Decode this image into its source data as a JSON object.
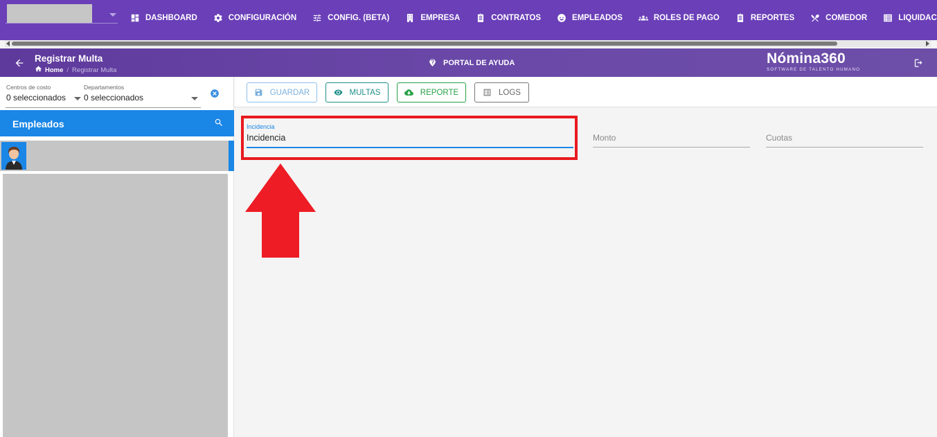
{
  "nav": {
    "items": [
      {
        "label": "DASHBOARD",
        "icon": "dashboard-icon"
      },
      {
        "label": "CONFIGURACIÓN",
        "icon": "gear-icon"
      },
      {
        "label": "CONFIG. (BETA)",
        "icon": "tune-icon"
      },
      {
        "label": "EMPRESA",
        "icon": "building-icon"
      },
      {
        "label": "CONTRATOS",
        "icon": "clipboard-icon"
      },
      {
        "label": "EMPLEADOS",
        "icon": "face-icon"
      },
      {
        "label": "ROLES DE PAGO",
        "icon": "group-icon"
      },
      {
        "label": "REPORTES",
        "icon": "clipboard-icon"
      },
      {
        "label": "COMEDOR",
        "icon": "cutlery-icon"
      },
      {
        "label": "LIQUIDACIONES",
        "icon": "list-icon"
      }
    ]
  },
  "header": {
    "title": "Registrar Multa",
    "breadcrumb_home": "Home",
    "breadcrumb_sep": "/",
    "breadcrumb_current": "Registrar Multa",
    "help_label": "PORTAL DE AYUDA",
    "brand_name": "Nómina360",
    "brand_tagline": "SOFTWARE DE TALENTO HUMANO"
  },
  "filters": {
    "cost_centers_label": "Centros de costo",
    "cost_centers_value": "0 seleccionados",
    "departments_label": "Departamentos",
    "departments_value": "0 seleccionados"
  },
  "employees": {
    "title": "Empleados"
  },
  "toolbar": {
    "guardar": "GUARDAR",
    "multas": "MULTAS",
    "reporte": "REPORTE",
    "logs": "LOGS"
  },
  "form": {
    "incidencia_label": "Incidencia",
    "incidencia_value": "Incidencia",
    "monto_placeholder": "Monto",
    "cuotas_placeholder": "Cuotas"
  },
  "colors": {
    "nav_bg": "#6a3fb8",
    "accent_blue": "#1a86e6",
    "highlight_red": "#e8191f"
  }
}
